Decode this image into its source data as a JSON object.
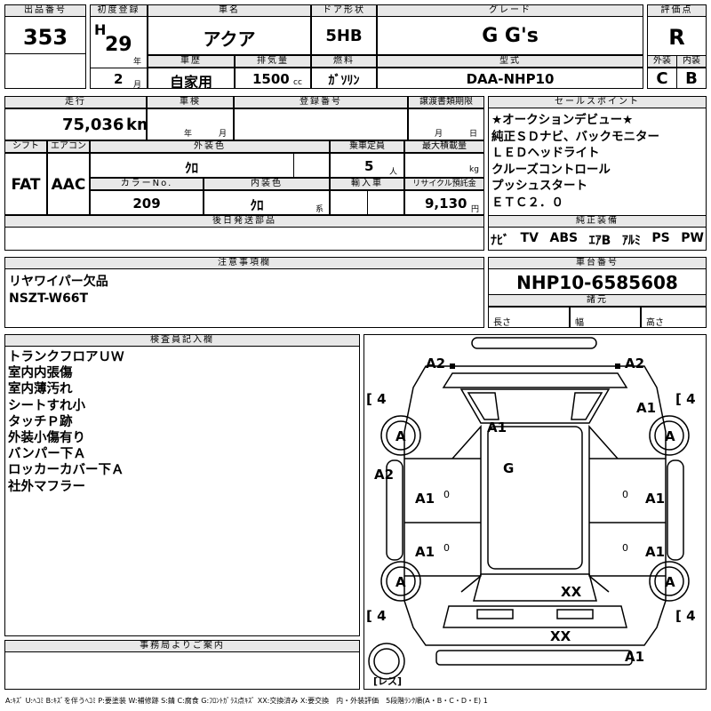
{
  "header": {
    "lot_label": "出品番号",
    "lot_value": "353",
    "first_reg_label": "初度登録",
    "era": "H",
    "year": "29",
    "year_unit": "年",
    "month": "2",
    "month_unit": "月",
    "car_name_label": "車名",
    "car_name": "アクア",
    "door_label": "ドア形状",
    "door": "5HB",
    "grade_label": "グレード",
    "grade": "G G's",
    "score_label": "評価点",
    "score": "R",
    "history_label": "車歴",
    "history": "自家用",
    "displacement_label": "排気量",
    "displacement": "1500",
    "displacement_unit": "cc",
    "fuel_label": "燃料",
    "fuel": "ｶﾞｿﾘﾝ",
    "model_label": "型式",
    "model": "DAA-NHP10",
    "ext_label": "外装",
    "ext_grade": "C",
    "int_label": "内装",
    "int_grade": "B"
  },
  "specs": {
    "mileage_label": "走行",
    "mileage": "75,036",
    "mileage_unit": "km",
    "inspection_label": "車検",
    "year_unit": "年",
    "month_unit": "月",
    "regno_label": "登録番号",
    "transfer_label": "譲渡書類期限",
    "day_unit": "日",
    "shift_label": "シフト",
    "shift": "FAT",
    "ac_label": "エアコン",
    "ac": "AAC",
    "ext_color_label": "外装色",
    "ext_color": "ｸﾛ",
    "capacity_label": "乗車定員",
    "capacity": "5",
    "capacity_unit": "人",
    "load_label": "最大積載量",
    "load_unit": "kg",
    "color_no_label": "カラーNo.",
    "color_no": "209",
    "int_color_label": "内装色",
    "int_color": "ｸﾛ",
    "int_color_unit": "系",
    "import_label": "輸入車",
    "recycle_label": "リサイクル預託金",
    "recycle": "9,130",
    "recycle_unit": "円",
    "later_label": "後日発送部品"
  },
  "sales_points": {
    "label": "セールスポイント",
    "lines": [
      "★オークションデビュー★",
      "純正ＳＤナビ、バックモニター",
      "ＬＥＤヘッドライト",
      "クルーズコントロール",
      "プッシュスタート",
      "ＥＴＣ２．０"
    ]
  },
  "equipment": {
    "label": "純正装備",
    "items": [
      "ﾅﾋﾞ",
      "TV",
      "ABS",
      "ｴｱB",
      "ｱﾙﾐ",
      "PS",
      "PW"
    ]
  },
  "notes": {
    "label": "注意事項欄",
    "lines": [
      "リヤワイパー欠品",
      "NSZT-W66T"
    ]
  },
  "chassis": {
    "label": "車台番号",
    "value": "NHP10-6585608",
    "specs_label": "諸元",
    "length_label": "長さ",
    "width_label": "幅",
    "height_label": "高さ"
  },
  "inspector": {
    "label": "検査員記入欄",
    "lines": [
      "トランクフロアＵＷ",
      "室内内張傷",
      "室内薄汚れ",
      "シートすれ小",
      "タッチＰ跡",
      "外装小傷有り",
      "バンパー下Ａ",
      "ロッカーカバー下Ａ",
      "社外マフラー"
    ]
  },
  "office": {
    "label": "事務局よりご案内"
  },
  "diagram": {
    "marks": {
      "a2_tl": "A2",
      "a2_tr": "A2",
      "a2_l": "A2",
      "a1_roof": "A1",
      "a1_fr": "A1",
      "a1_l1": "A1",
      "a1_l2": "A1",
      "a1_r1": "A1",
      "a1_r2": "A1",
      "a1_rear": "A1",
      "g_glass": "G",
      "xx_rear": "XX",
      "xx_bumper": "XX",
      "tire_fl": "A",
      "tire_fr": "A",
      "tire_rl": "A",
      "tire_rr": "A",
      "tread_fl": "4",
      "tread_fr": "4",
      "tread_rl": "4",
      "tread_rr": "4",
      "zero_l1": "0",
      "zero_l2": "0",
      "zero_r1": "0",
      "zero_r2": "0",
      "spare": "レス"
    }
  },
  "legend": "A:ｷｽﾞ U:ﾍｺﾐ B:ｷｽﾞを伴うﾍｺﾐ P:要塗装 W:補修跡 S:錆 C:腐食 G:ﾌﾛﾝﾄｶﾞﾗｽ点ｷｽﾞ XX:交換済み X:要交換　内・外装評価　5段階ﾗﾝｸ順(A・B・C・D・E) 1"
}
